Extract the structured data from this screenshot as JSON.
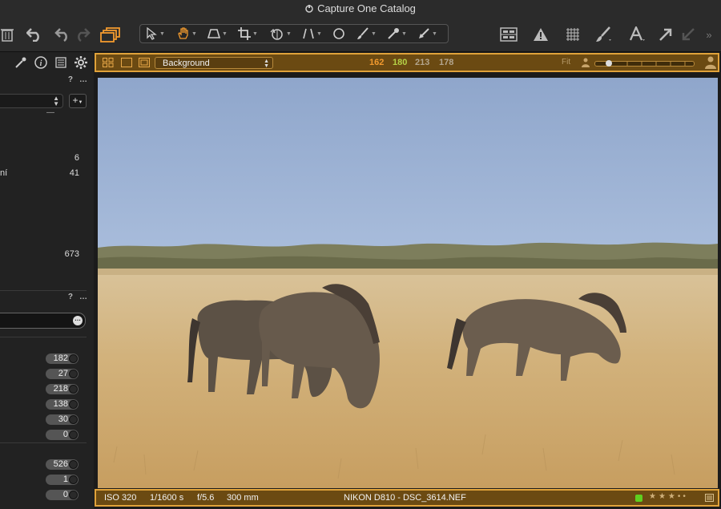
{
  "window": {
    "title": "Capture One Catalog"
  },
  "toolbar": {
    "icons": [
      "trash-icon",
      "undo-icon",
      "undo-step-icon",
      "redo-icon",
      "stack-icon",
      "select-cursor-icon",
      "pan-icon",
      "keystone-icon",
      "crop-icon",
      "rotate-icon",
      "straighten-icon",
      "circle-spot-icon",
      "brush-icon",
      "picker-icon",
      "annotate-icon",
      "grid-view-icon",
      "warning-icon",
      "grid-overlay-icon",
      "brush-adjust-icon",
      "text-icon",
      "export-icon",
      "import-icon"
    ],
    "accent_color": "#f29a2e"
  },
  "left_panel": {
    "help_label": "?",
    "more_label": "…",
    "dash": "—",
    "rows": [
      {
        "label": "",
        "value": "6"
      },
      {
        "label": "ní",
        "value": "41"
      },
      {
        "label": "",
        "value": "673"
      }
    ],
    "search_more": "…",
    "plus_label": "+",
    "pills_a": [
      "182",
      "27",
      "218",
      "138",
      "30",
      "0"
    ],
    "pills_b": [
      "526",
      "1",
      "0"
    ]
  },
  "viewer": {
    "layer_name": "Background",
    "rgb": {
      "r": "162",
      "g": "180",
      "b": "213",
      "l": "178"
    },
    "rgb_colors": {
      "r": "#f29a2e",
      "g": "#b5d147",
      "b": "#b3a58e",
      "l": "#b3a58e"
    },
    "fit_label": "Fit",
    "zoom_fraction": 0.1
  },
  "info": {
    "iso": "ISO 320",
    "shutter": "1/1600 s",
    "aperture": "f/5.6",
    "focal": "300 mm",
    "camera_file": "NIKON D810 - DSC_3614.NEF",
    "color_tag": "#5fcf1f",
    "rating_text": "★★★••"
  }
}
